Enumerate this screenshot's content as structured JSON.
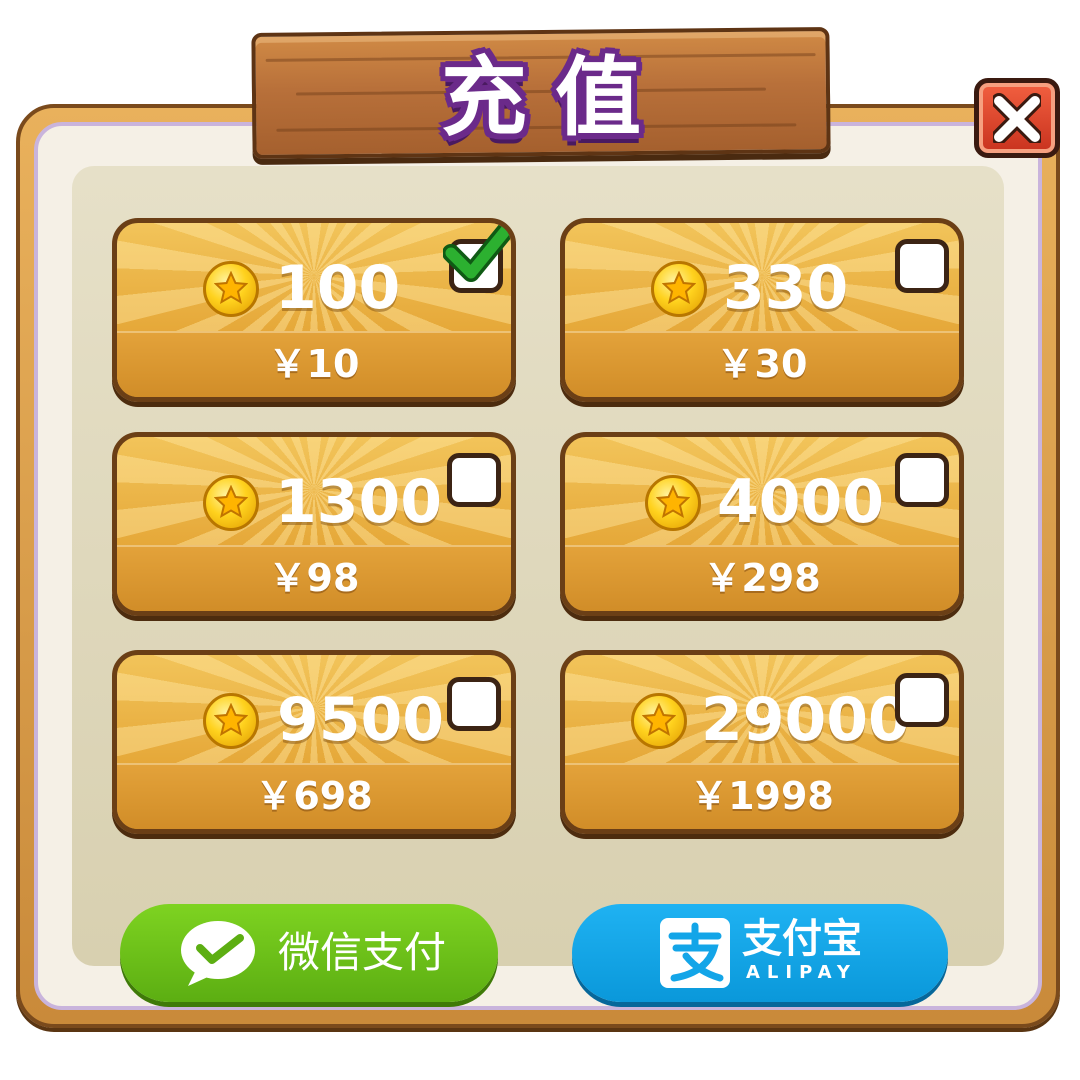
{
  "dialog": {
    "title": "充值",
    "close_icon": "close-x-icon"
  },
  "options": [
    {
      "coins": "100",
      "price": "￥10",
      "selected": true
    },
    {
      "coins": "330",
      "price": "￥30",
      "selected": false
    },
    {
      "coins": "1300",
      "price": "￥98",
      "selected": false
    },
    {
      "coins": "4000",
      "price": "￥298",
      "selected": false
    },
    {
      "coins": "9500",
      "price": "￥698",
      "selected": false
    },
    {
      "coins": "29000",
      "price": "￥1998",
      "selected": false
    }
  ],
  "payment": {
    "wechat": {
      "label": "微信支付",
      "icon": "wechat-pay-icon",
      "color": "#6cc41a"
    },
    "alipay": {
      "label_cn": "支付宝",
      "label_en": "ALIPAY",
      "icon": "alipay-icon",
      "color": "#13a5e8"
    }
  },
  "colors": {
    "frame": "#c98a3a",
    "card": "#e6a93a",
    "title_outline": "#6b2a8a",
    "check": "#1f9a2a",
    "close": "#d83c24"
  }
}
